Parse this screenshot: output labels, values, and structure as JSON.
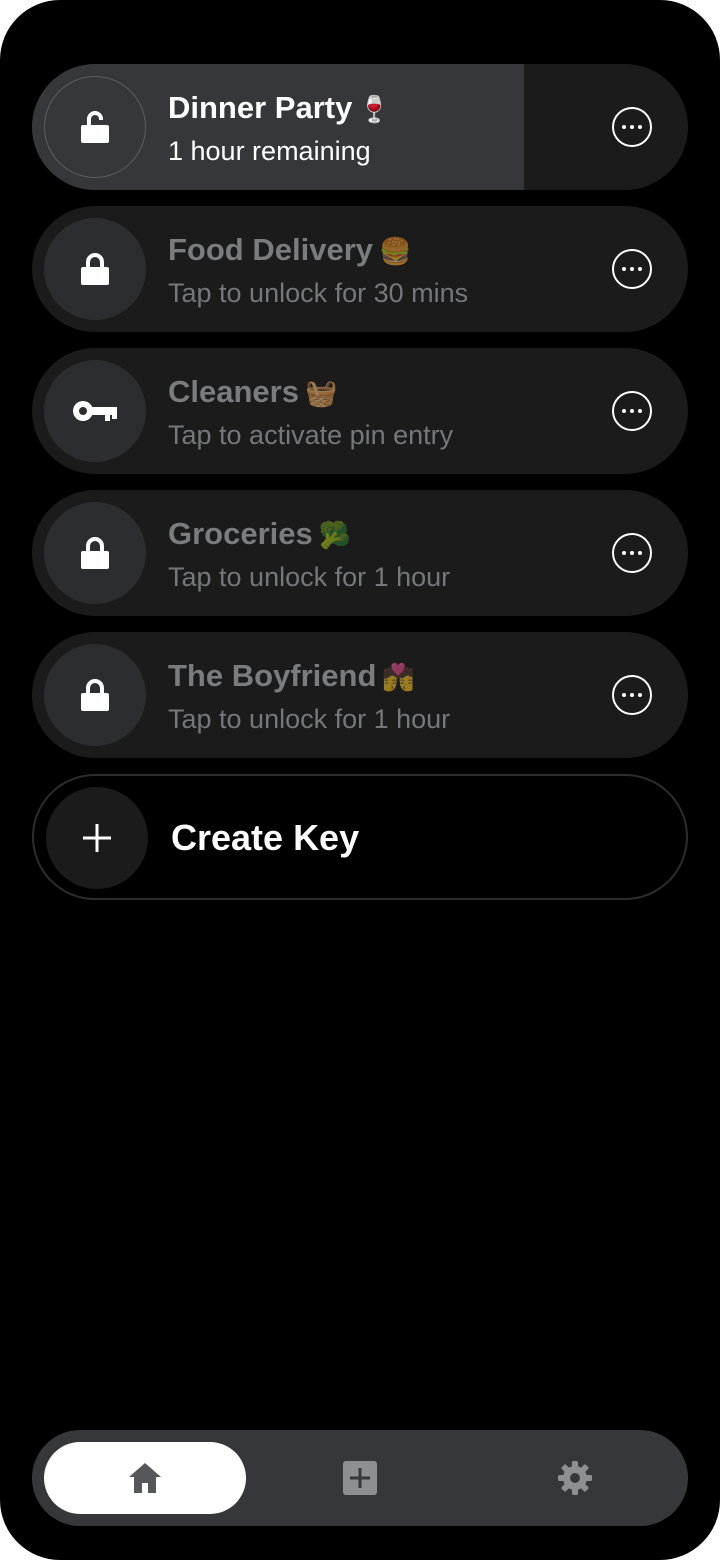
{
  "keys": [
    {
      "name": "Dinner Party",
      "emoji": "🍷",
      "status": "1 hour remaining",
      "state": "unlocked",
      "icon": "unlocked-padlock-icon",
      "remaining_fraction": 0.75
    },
    {
      "name": "Food Delivery",
      "emoji": "🍔",
      "status": "Tap to unlock for 30 mins",
      "state": "locked",
      "icon": "padlock-icon"
    },
    {
      "name": "Cleaners",
      "emoji": "🧺",
      "status": "Tap to activate pin entry",
      "state": "pin",
      "icon": "key-icon"
    },
    {
      "name": "Groceries",
      "emoji": "🥦",
      "status": "Tap to unlock for 1 hour",
      "state": "locked",
      "icon": "padlock-icon"
    },
    {
      "name": "The Boyfriend",
      "emoji": "💏",
      "status": "Tap to unlock for 1 hour",
      "state": "locked",
      "icon": "padlock-icon"
    }
  ],
  "create_key": {
    "label": "Create Key",
    "icon": "plus-icon"
  },
  "tab_bar": {
    "tabs": [
      {
        "icon": "home-icon",
        "selected": true
      },
      {
        "icon": "add-square-icon",
        "selected": false
      },
      {
        "icon": "gear-icon",
        "selected": false
      }
    ]
  },
  "colors": {
    "background": "#000000",
    "row": "#1b1b1c",
    "row_active": "#36373a",
    "icon_circle": "#2c2d30",
    "muted_text": "#7b7c7e",
    "tab_bar": "#36373a",
    "tab_icon": "#8e8f92"
  }
}
